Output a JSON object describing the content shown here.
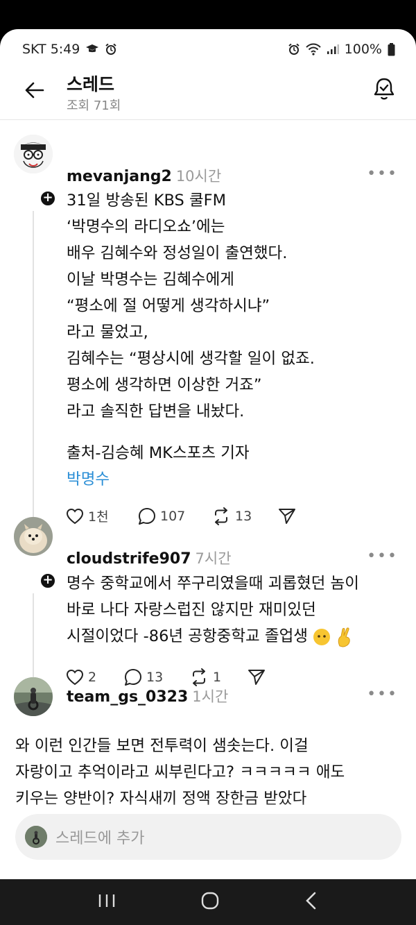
{
  "status_bar": {
    "carrier_time": "SKT 5:49",
    "battery": "100%"
  },
  "header": {
    "title": "스레드",
    "views": "조회 71회"
  },
  "posts": [
    {
      "username": "mevanjang2",
      "time": "10시간",
      "lines": [
        "31일 방송된 KBS 쿨FM",
        "‘박명수의 라디오쇼’에는",
        "배우 김혜수와 정성일이 출연했다.",
        "이날 박명수는 김혜수에게",
        "“평소에 절 어떻게 생각하시냐”",
        "라고 물었고,",
        "김혜수는 “평상시에 생각할 일이 없죠.",
        "평소에 생각하면 이상한 거죠”",
        "라고 솔직한 답변을 내놨다."
      ],
      "source": "출처-김승혜 MK스포츠 기자",
      "tag": "박명수",
      "likes": "1천",
      "replies": "107",
      "reposts": "13"
    },
    {
      "username": "cloudstrife907",
      "time": "7시간",
      "lines": [
        "명수 중학교에서 쭈구리였을때 괴롭혔던 놈이",
        "바로 나다 자랑스럽진 않지만 재미있던",
        "시절이었다 -86년 공항중학교 졸업생"
      ],
      "likes": "2",
      "replies": "13",
      "reposts": "1"
    },
    {
      "username": "team_gs_0323",
      "time": "1시간",
      "lines": [
        "와 이런 인간들 보면 전투력이 샘솟는다. 이걸",
        "자랑이고 추억이라고 씨부린다고? ㅋㅋㅋㅋㅋ 애도",
        "키우는 양반이? 자식새끼 정액 장한금 받았다"
      ]
    }
  ],
  "compose": {
    "placeholder": "스레드에 추가"
  }
}
